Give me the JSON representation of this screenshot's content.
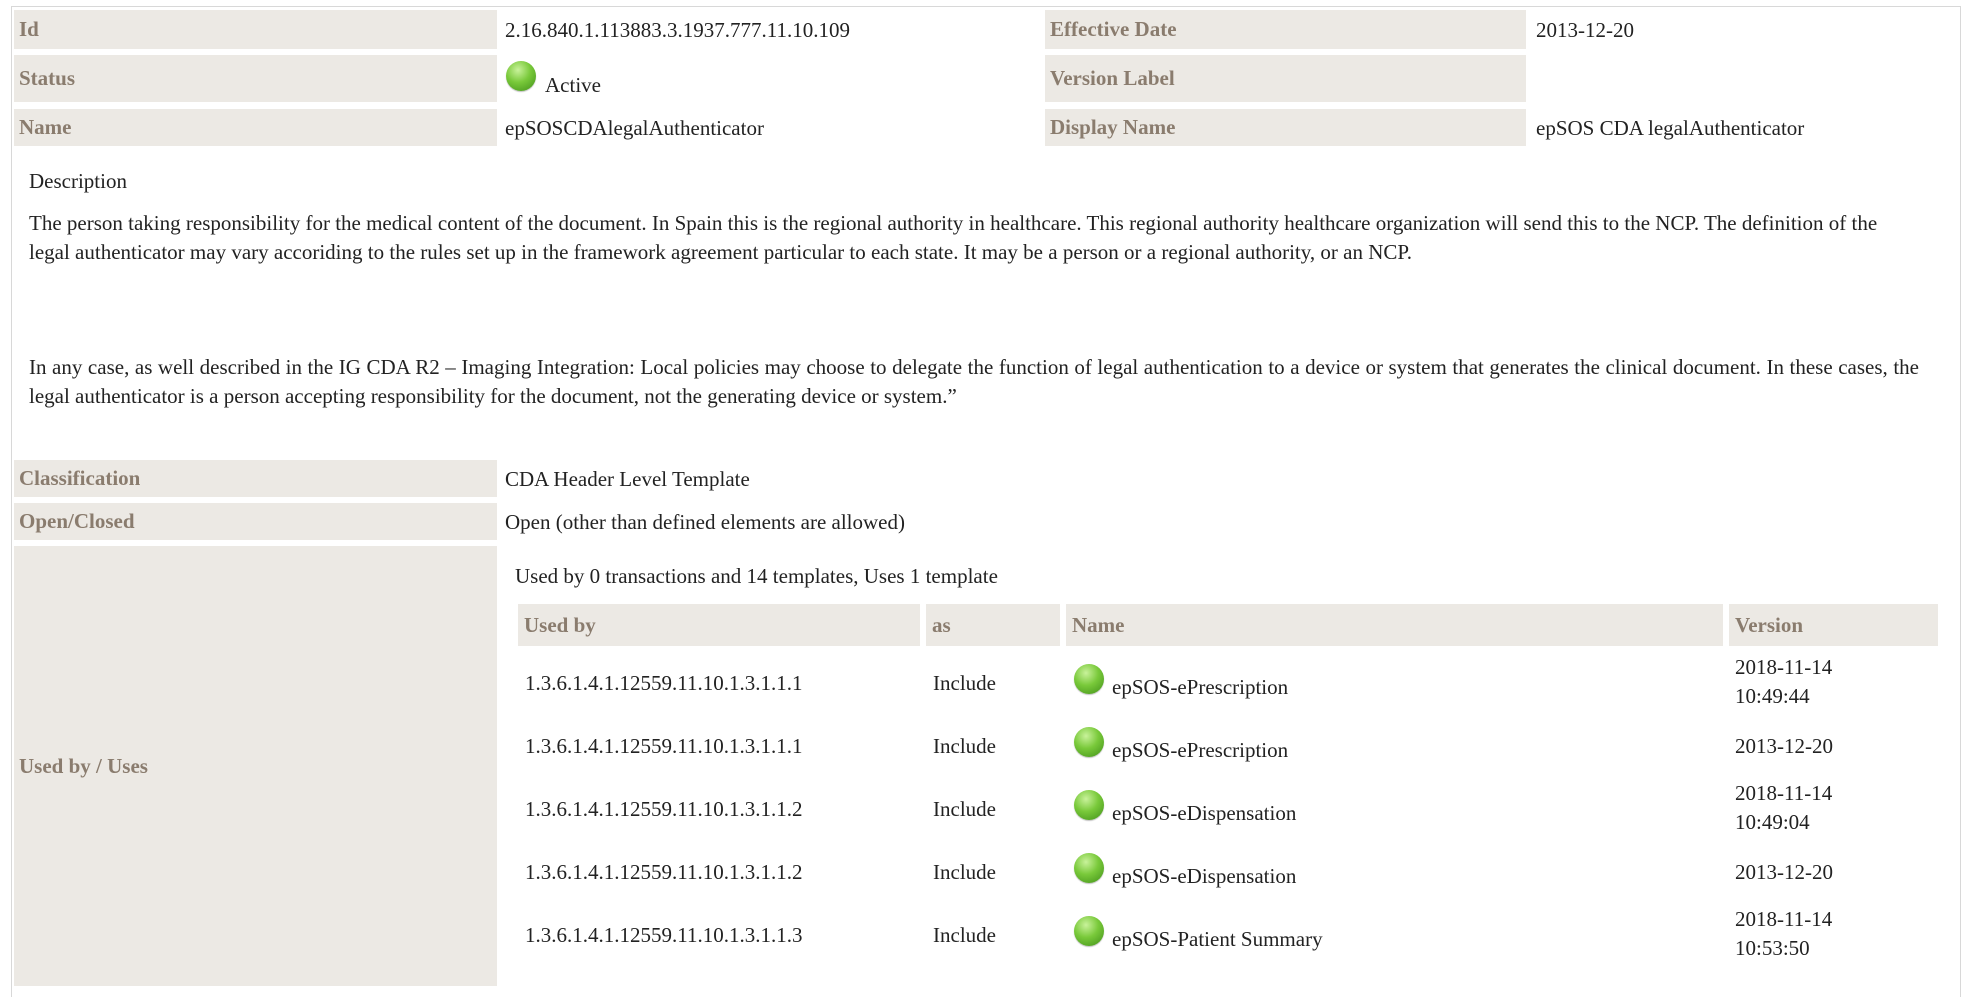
{
  "meta": {
    "id_label": "Id",
    "id_value": "2.16.840.1.113883.3.1937.777.11.10.109",
    "effective_date_label": "Effective Date",
    "effective_date_value": "2013-12-20",
    "status_label": "Status",
    "status_value": "Active",
    "status_icon": "green-status-icon",
    "version_label_label": "Version Label",
    "version_label_value": "",
    "name_label": "Name",
    "name_value": "epSOSCDAlegalAuthenticator",
    "display_name_label": "Display Name",
    "display_name_value": "epSOS CDA legalAuthenticator"
  },
  "description": {
    "heading": "Description",
    "paragraph1": "The person taking responsibility for the medical content of the document. In Spain this is the regional authority in healthcare. This regional authority healthcare organization will send this to the NCP. The definition of the legal authenticator may vary accoriding to the rules set up in the framework agreement particular to each state. It may be a person or a regional authority, or an NCP.",
    "paragraph2": "In any case, as well described in the IG CDA R2 – Imaging Integration: Local policies may choose to delegate the function of legal authentication to a device or system that generates the clinical document. In these cases, the legal authenticator is a person accepting responsibility for the document, not the generating device or system.”"
  },
  "classification": {
    "label": "Classification",
    "value": "CDA Header Level Template"
  },
  "open_closed": {
    "label": "Open/Closed",
    "value": "Open (other than defined elements are allowed)"
  },
  "used_by": {
    "label": "Used by / Uses",
    "summary": "Used by 0 transactions and 14 templates, Uses 1 template",
    "columns": [
      "Used by",
      "as",
      "Name",
      "Version"
    ],
    "rows": [
      {
        "id": "1.3.6.1.4.1.12559.11.10.1.3.1.1.1",
        "as": "Include",
        "name": "epSOS-ePrescription",
        "version_date": "2018-11-14",
        "version_time": "10:49:44"
      },
      {
        "id": "1.3.6.1.4.1.12559.11.10.1.3.1.1.1",
        "as": "Include",
        "name": "epSOS-ePrescription",
        "version_date": "2013-12-20",
        "version_time": ""
      },
      {
        "id": "1.3.6.1.4.1.12559.11.10.1.3.1.1.2",
        "as": "Include",
        "name": "epSOS-eDispensation",
        "version_date": "2018-11-14",
        "version_time": "10:49:04"
      },
      {
        "id": "1.3.6.1.4.1.12559.11.10.1.3.1.1.2",
        "as": "Include",
        "name": "epSOS-eDispensation",
        "version_date": "2013-12-20",
        "version_time": ""
      },
      {
        "id": "1.3.6.1.4.1.12559.11.10.1.3.1.1.3",
        "as": "Include",
        "name": "epSOS-Patient Summary",
        "version_date": "2018-11-14",
        "version_time": "10:53:50"
      }
    ]
  },
  "colors": {
    "label_bg": "#ece9e4",
    "label_text": "#8a7c6e",
    "status_ok": "#79c93a"
  }
}
